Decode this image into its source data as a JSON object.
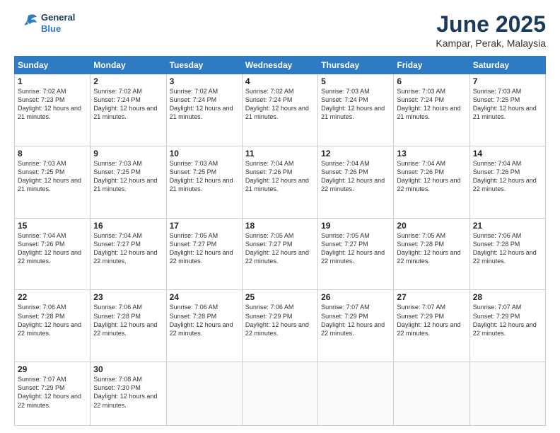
{
  "header": {
    "logo_line1": "General",
    "logo_line2": "Blue",
    "month": "June 2025",
    "location": "Kampar, Perak, Malaysia"
  },
  "weekdays": [
    "Sunday",
    "Monday",
    "Tuesday",
    "Wednesday",
    "Thursday",
    "Friday",
    "Saturday"
  ],
  "weeks": [
    [
      {
        "day": "1",
        "sunrise": "7:02 AM",
        "sunset": "7:23 PM",
        "daylight": "12 hours and 21 minutes."
      },
      {
        "day": "2",
        "sunrise": "7:02 AM",
        "sunset": "7:24 PM",
        "daylight": "12 hours and 21 minutes."
      },
      {
        "day": "3",
        "sunrise": "7:02 AM",
        "sunset": "7:24 PM",
        "daylight": "12 hours and 21 minutes."
      },
      {
        "day": "4",
        "sunrise": "7:02 AM",
        "sunset": "7:24 PM",
        "daylight": "12 hours and 21 minutes."
      },
      {
        "day": "5",
        "sunrise": "7:03 AM",
        "sunset": "7:24 PM",
        "daylight": "12 hours and 21 minutes."
      },
      {
        "day": "6",
        "sunrise": "7:03 AM",
        "sunset": "7:24 PM",
        "daylight": "12 hours and 21 minutes."
      },
      {
        "day": "7",
        "sunrise": "7:03 AM",
        "sunset": "7:25 PM",
        "daylight": "12 hours and 21 minutes."
      }
    ],
    [
      {
        "day": "8",
        "sunrise": "7:03 AM",
        "sunset": "7:25 PM",
        "daylight": "12 hours and 21 minutes."
      },
      {
        "day": "9",
        "sunrise": "7:03 AM",
        "sunset": "7:25 PM",
        "daylight": "12 hours and 21 minutes."
      },
      {
        "day": "10",
        "sunrise": "7:03 AM",
        "sunset": "7:25 PM",
        "daylight": "12 hours and 21 minutes."
      },
      {
        "day": "11",
        "sunrise": "7:04 AM",
        "sunset": "7:26 PM",
        "daylight": "12 hours and 21 minutes."
      },
      {
        "day": "12",
        "sunrise": "7:04 AM",
        "sunset": "7:26 PM",
        "daylight": "12 hours and 22 minutes."
      },
      {
        "day": "13",
        "sunrise": "7:04 AM",
        "sunset": "7:26 PM",
        "daylight": "12 hours and 22 minutes."
      },
      {
        "day": "14",
        "sunrise": "7:04 AM",
        "sunset": "7:26 PM",
        "daylight": "12 hours and 22 minutes."
      }
    ],
    [
      {
        "day": "15",
        "sunrise": "7:04 AM",
        "sunset": "7:26 PM",
        "daylight": "12 hours and 22 minutes."
      },
      {
        "day": "16",
        "sunrise": "7:04 AM",
        "sunset": "7:27 PM",
        "daylight": "12 hours and 22 minutes."
      },
      {
        "day": "17",
        "sunrise": "7:05 AM",
        "sunset": "7:27 PM",
        "daylight": "12 hours and 22 minutes."
      },
      {
        "day": "18",
        "sunrise": "7:05 AM",
        "sunset": "7:27 PM",
        "daylight": "12 hours and 22 minutes."
      },
      {
        "day": "19",
        "sunrise": "7:05 AM",
        "sunset": "7:27 PM",
        "daylight": "12 hours and 22 minutes."
      },
      {
        "day": "20",
        "sunrise": "7:05 AM",
        "sunset": "7:28 PM",
        "daylight": "12 hours and 22 minutes."
      },
      {
        "day": "21",
        "sunrise": "7:06 AM",
        "sunset": "7:28 PM",
        "daylight": "12 hours and 22 minutes."
      }
    ],
    [
      {
        "day": "22",
        "sunrise": "7:06 AM",
        "sunset": "7:28 PM",
        "daylight": "12 hours and 22 minutes."
      },
      {
        "day": "23",
        "sunrise": "7:06 AM",
        "sunset": "7:28 PM",
        "daylight": "12 hours and 22 minutes."
      },
      {
        "day": "24",
        "sunrise": "7:06 AM",
        "sunset": "7:28 PM",
        "daylight": "12 hours and 22 minutes."
      },
      {
        "day": "25",
        "sunrise": "7:06 AM",
        "sunset": "7:29 PM",
        "daylight": "12 hours and 22 minutes."
      },
      {
        "day": "26",
        "sunrise": "7:07 AM",
        "sunset": "7:29 PM",
        "daylight": "12 hours and 22 minutes."
      },
      {
        "day": "27",
        "sunrise": "7:07 AM",
        "sunset": "7:29 PM",
        "daylight": "12 hours and 22 minutes."
      },
      {
        "day": "28",
        "sunrise": "7:07 AM",
        "sunset": "7:29 PM",
        "daylight": "12 hours and 22 minutes."
      }
    ],
    [
      {
        "day": "29",
        "sunrise": "7:07 AM",
        "sunset": "7:29 PM",
        "daylight": "12 hours and 22 minutes."
      },
      {
        "day": "30",
        "sunrise": "7:08 AM",
        "sunset": "7:30 PM",
        "daylight": "12 hours and 22 minutes."
      },
      null,
      null,
      null,
      null,
      null
    ]
  ]
}
